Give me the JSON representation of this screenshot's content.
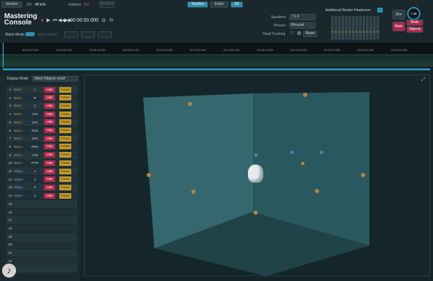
{
  "header": {
    "session": "Session",
    "sd_label": "SD",
    "sample_rate": "48 kHz",
    "gapless_label": "Gapless",
    "gapless_value": "NO",
    "no_error": "No Error",
    "tabs": [
      "Timeline",
      "Editor",
      "3D"
    ],
    "timecode": "00:00:00.000",
    "batch_mode": "Batch Mode",
    "album_mode": "Album Mode"
  },
  "logo": {
    "line1": "Mastering",
    "line2": "Console"
  },
  "routing": {
    "speakers_label": "Speakers",
    "speakers_value": "7.1.4",
    "phones_label": "Phones",
    "phones_value": "Binaural",
    "head_tracking": "Head Tracking",
    "reset": "Reset"
  },
  "render": {
    "title": "Additional Render Headroom",
    "meter_value": "S"
  },
  "monitor": {
    "dim": "Dim",
    "mute": "Mute",
    "value": "0 dB",
    "beds": "Beds",
    "objects": "Objects"
  },
  "timeline": {
    "ticks": [
      "00:02:00.000",
      "00:04:00.000",
      "00:06:00.000",
      "00:08:00.000",
      "00:10:00.000",
      "00:12:00.000",
      "00:14:00.000",
      "00:16:00.000",
      "00:18:00.000",
      "00:20:00.000",
      "00:22:00.000",
      "00:24:00.000"
    ]
  },
  "display": {
    "label": "Display Mode",
    "value": "Silent Objects small"
  },
  "rows": [
    {
      "n": "1",
      "type": "Bed 1",
      "ch": "L",
      "hide": "Hide",
      "focus": "Focus"
    },
    {
      "n": "2",
      "type": "Bed 1",
      "ch": "R",
      "hide": "Hide",
      "focus": "Focus"
    },
    {
      "n": "3",
      "type": "Bed 1",
      "ch": "C",
      "hide": "Hide",
      "focus": "Focus"
    },
    {
      "n": "4",
      "type": "Bed 1",
      "ch": "LFE",
      "hide": "Hide",
      "focus": "Focus"
    },
    {
      "n": "5",
      "type": "Bed 1",
      "ch": "LSS",
      "hide": "Hide",
      "focus": "Focus"
    },
    {
      "n": "6",
      "type": "Bed 1",
      "ch": "RSS",
      "hide": "Hide",
      "focus": "Focus"
    },
    {
      "n": "7",
      "type": "Bed 1",
      "ch": "LRS",
      "hide": "Hide",
      "focus": "Focus"
    },
    {
      "n": "8",
      "type": "Bed 1",
      "ch": "RRS",
      "hide": "Hide",
      "focus": "Focus"
    },
    {
      "n": "9",
      "type": "Bed 1",
      "ch": "LTM",
      "hide": "Hide",
      "focus": "Focus"
    },
    {
      "n": "10",
      "type": "Bed 1",
      "ch": "RTM",
      "hide": "Hide",
      "focus": "Focus"
    },
    {
      "n": "11",
      "type": "Object",
      "ch": "1",
      "hide": "Hide",
      "focus": "Focus"
    },
    {
      "n": "12",
      "type": "Object",
      "ch": "2",
      "hide": "Hide",
      "focus": "Focus"
    },
    {
      "n": "13",
      "type": "Object",
      "ch": "3",
      "hide": "Hide",
      "focus": "Focus"
    },
    {
      "n": "14",
      "type": "Object",
      "ch": "4",
      "hide": "Hide",
      "focus": "Focus"
    }
  ],
  "empty_rows": [
    "15",
    "16",
    "17",
    "18",
    "19",
    "20",
    "21",
    "22",
    "23"
  ],
  "colors": {
    "accent": "#2b8fb0",
    "hide": "#b3284a",
    "focus": "#c79a26",
    "bed": "#d59c4a",
    "object": "#6fa3d8",
    "room": "#3f8a93"
  }
}
